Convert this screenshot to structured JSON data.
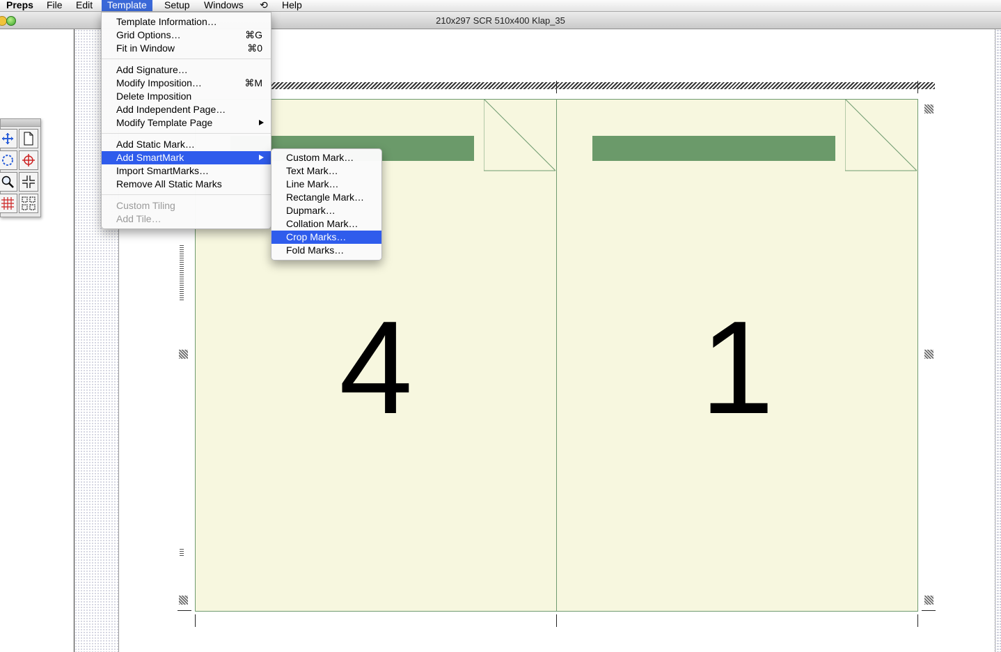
{
  "menubar": {
    "app": "Preps",
    "items": [
      "File",
      "Edit",
      "Template",
      "Setup",
      "Windows",
      "⟲",
      "Help"
    ],
    "active": "Template"
  },
  "window": {
    "title": "210x297 SCR 510x400 Klap_35"
  },
  "pages": [
    {
      "number": "4"
    },
    {
      "number": "1"
    }
  ],
  "template_menu": {
    "items": [
      {
        "label": "Template Information…",
        "shortcut": ""
      },
      {
        "label": "Grid Options…",
        "shortcut": "⌘G"
      },
      {
        "label": "Fit in Window",
        "shortcut": "⌘0"
      },
      {
        "label": "Add Signature…",
        "shortcut": ""
      },
      {
        "label": "Modify Imposition…",
        "shortcut": "⌘M"
      },
      {
        "label": "Delete Imposition",
        "shortcut": ""
      },
      {
        "label": "Add Independent Page…",
        "shortcut": ""
      },
      {
        "label": "Modify Template Page",
        "shortcut": ""
      },
      {
        "label": "Add Static Mark…",
        "shortcut": ""
      },
      {
        "label": "Add SmartMark",
        "shortcut": ""
      },
      {
        "label": "Import SmartMarks…",
        "shortcut": ""
      },
      {
        "label": "Remove All Static Marks",
        "shortcut": ""
      },
      {
        "label": "Custom Tiling",
        "shortcut": ""
      },
      {
        "label": "Add Tile…",
        "shortcut": ""
      }
    ]
  },
  "smartmark_submenu": {
    "items": [
      {
        "label": "Custom Mark…"
      },
      {
        "label": "Text Mark…"
      },
      {
        "label": "Line Mark…"
      },
      {
        "label": "Rectangle Mark…"
      },
      {
        "label": "Dupmark…"
      },
      {
        "label": "Collation Mark…"
      },
      {
        "label": "Crop Marks…"
      },
      {
        "label": "Fold Marks…"
      }
    ],
    "highlighted": "Crop Marks…"
  },
  "palette": {
    "tools": [
      "move-icon",
      "page-icon",
      "lasso-icon",
      "crosshair-icon",
      "zoom-icon",
      "corner-marks-icon",
      "grid-icon",
      "cells-icon"
    ]
  },
  "colors": {
    "menu_highlight": "#2f5cec",
    "page_fill": "#f7f7df",
    "page_bar": "#6b9a6a"
  }
}
